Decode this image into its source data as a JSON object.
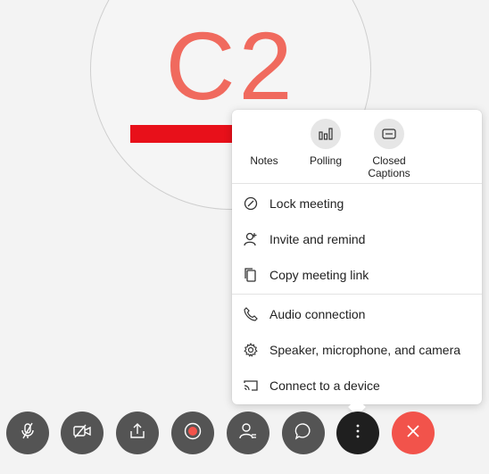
{
  "avatar": {
    "initials": "C2",
    "color": "#f06a5e"
  },
  "annotation": {
    "arrow_color": "#e8101a"
  },
  "more_menu": {
    "quick_actions": [
      {
        "id": "notes",
        "label": "Notes",
        "icon": "notes-icon"
      },
      {
        "id": "polling",
        "label": "Polling",
        "icon": "polling-icon"
      },
      {
        "id": "closed_captions",
        "label": "Closed\nCaptions",
        "icon": "closed-captions-icon"
      }
    ],
    "items": [
      {
        "id": "lock",
        "label": "Lock meeting",
        "icon": "lock-meeting-icon"
      },
      {
        "id": "invite",
        "label": "Invite and remind",
        "icon": "invite-icon"
      },
      {
        "id": "copy",
        "label": "Copy meeting link",
        "icon": "copy-link-icon"
      },
      {
        "id": "audio",
        "label": "Audio connection",
        "icon": "phone-icon"
      },
      {
        "id": "settings",
        "label": "Speaker, microphone, and camera",
        "icon": "gear-icon"
      },
      {
        "id": "device",
        "label": "Connect to a device",
        "icon": "cast-icon"
      }
    ]
  },
  "toolbar": {
    "buttons": [
      {
        "id": "mute",
        "icon": "microphone-muted-icon"
      },
      {
        "id": "video",
        "icon": "video-off-icon"
      },
      {
        "id": "share",
        "icon": "share-icon"
      },
      {
        "id": "record",
        "icon": "record-icon"
      },
      {
        "id": "participants",
        "icon": "participants-icon"
      },
      {
        "id": "chat",
        "icon": "chat-icon"
      },
      {
        "id": "more",
        "icon": "more-options-icon"
      },
      {
        "id": "end",
        "icon": "close-icon"
      }
    ],
    "end_color": "#f2534b"
  }
}
